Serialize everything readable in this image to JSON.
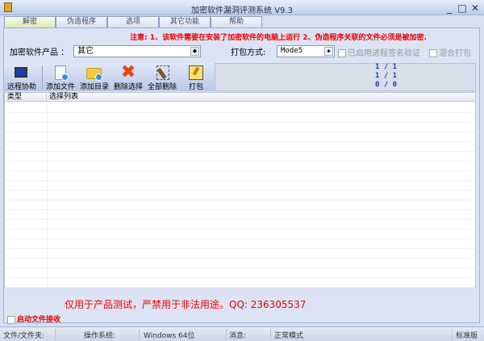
{
  "window": {
    "title": "加密软件漏洞评测系统 V9.3"
  },
  "tabs": [
    "解密",
    "伪造程序",
    "选项",
    "其它功能",
    "帮助"
  ],
  "notice": "注意: 1、该软件需要在安装了加密软件的电脑上运行  2、伪造程序关联的文件必须是被加密.",
  "form": {
    "product_label": "加密软件产品 ：",
    "product_value": "其它",
    "pack_label": "打包方式:",
    "pack_value": "Mode5",
    "sign_check": "已启用进程签名验证",
    "mix_check": "混合打包"
  },
  "toolbar": {
    "remote": "远程协助",
    "add_file": "添加文件",
    "add_dir": "添加目录",
    "delete_sel": "删除选择",
    "delete_all": "全部删除",
    "pack": "打包"
  },
  "counters": [
    "1 / 1",
    "1 / 1",
    "0 / 0"
  ],
  "table": {
    "columns": [
      "类型",
      "选择列表"
    ]
  },
  "warning": "仅用于产品测试，严禁用于非法用途。QQ: 236305537",
  "receive_check": "启动文件接收",
  "status": {
    "file_label": "文件/文件夹:",
    "os_label": "操作系统:",
    "os_value": "Windows 64位",
    "msg_label": "消息:",
    "msg_value": "正常模式",
    "edition": "标准版"
  }
}
